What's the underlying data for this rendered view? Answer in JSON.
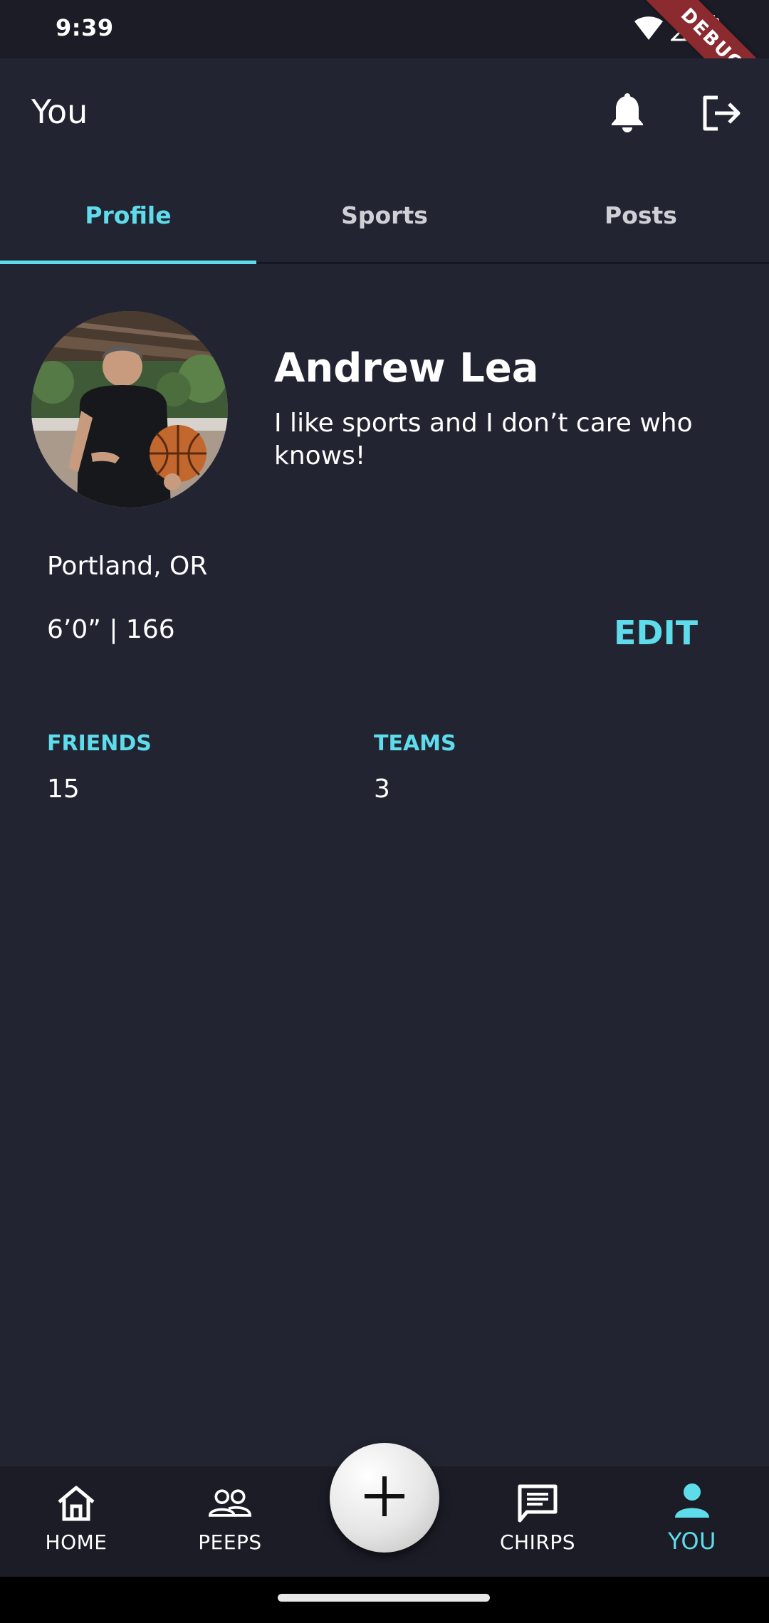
{
  "status_bar": {
    "time": "9:39",
    "debug_label": "DEBUG"
  },
  "app_bar": {
    "title": "You",
    "actions": [
      "notifications-icon",
      "logout-icon"
    ]
  },
  "tabs": [
    {
      "label": "Profile",
      "active": true
    },
    {
      "label": "Sports",
      "active": false
    },
    {
      "label": "Posts",
      "active": false
    }
  ],
  "profile": {
    "name": "Andrew Lea",
    "bio": "I like sports and I don’t care who knows!",
    "location": "Portland, OR",
    "height_weight": "6’0” | 166",
    "edit_label": "EDIT",
    "friends_label": "FRIENDS",
    "friends_count": "15",
    "teams_label": "TEAMS",
    "teams_count": "3"
  },
  "bottom_nav": [
    {
      "label": "HOME",
      "icon": "home-icon",
      "active": false
    },
    {
      "label": "PEEPS",
      "icon": "people-icon",
      "active": false
    },
    {
      "label": "CHIRPS",
      "icon": "chat-icon",
      "active": false
    },
    {
      "label": "YOU",
      "icon": "person-icon",
      "active": true
    }
  ],
  "colors": {
    "background": "#222431",
    "accent": "#5fdcec",
    "bar": "#1b1c26"
  }
}
